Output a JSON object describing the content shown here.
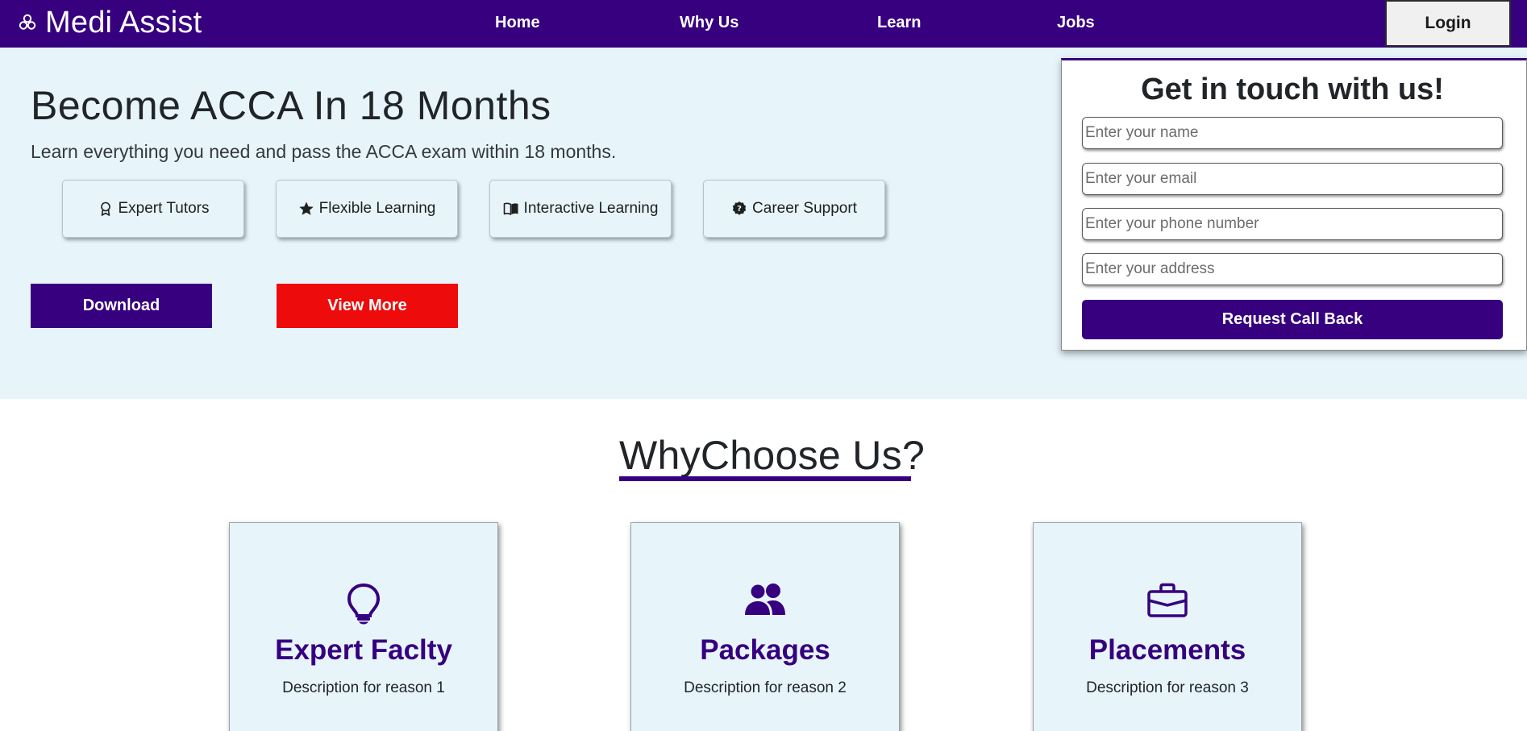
{
  "navbar": {
    "brand": "Medi Assist",
    "links": [
      "Home",
      "Why Us",
      "Learn",
      "Jobs"
    ],
    "login_label": "Login"
  },
  "hero": {
    "title": "Become ACCA In 18 Months",
    "subtitle": "Learn everything you need and pass the ACCA exam within 18 months.",
    "features": [
      {
        "label": "Expert Tutors",
        "icon": "award-icon"
      },
      {
        "label": "Flexible Learning",
        "icon": "star-icon"
      },
      {
        "label": "Interactive Learning",
        "icon": "book-icon"
      },
      {
        "label": "Career Support",
        "icon": "question-badge-icon"
      }
    ],
    "download_label": "Download",
    "view_more_label": "View More"
  },
  "contact": {
    "title": "Get in touch with us!",
    "name_placeholder": "Enter your name",
    "email_placeholder": "Enter your email",
    "phone_placeholder": "Enter your phone number",
    "address_placeholder": "Enter your address",
    "submit_label": "Request Call Back"
  },
  "why": {
    "title": "WhyChoose Us?",
    "cards": [
      {
        "title": "Expert Faclty",
        "description": "Description for reason 1",
        "icon": "lightbulb-icon"
      },
      {
        "title": "Packages",
        "description": "Description for reason 2",
        "icon": "people-icon"
      },
      {
        "title": "Placements",
        "description": "Description for reason 3",
        "icon": "briefcase-icon"
      }
    ]
  },
  "colors": {
    "primary": "#36007f",
    "accent_red": "#ee0b0b",
    "hero_bg": "#e7f5fb"
  }
}
